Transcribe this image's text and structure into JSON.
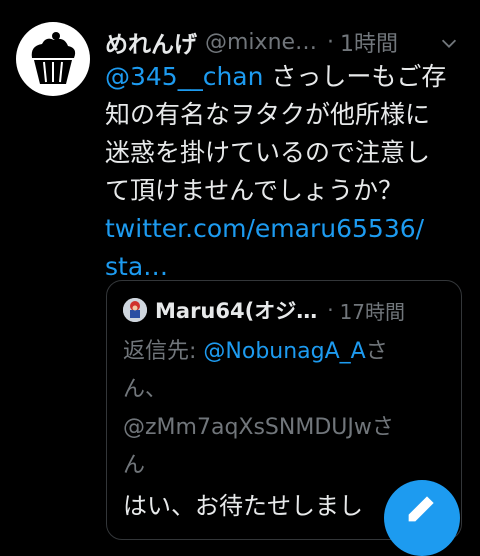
{
  "tweet": {
    "display_name": "めれんげ",
    "handle": "@mixne…",
    "separator": "·",
    "time": "1時間",
    "text": {
      "mention": "@345__chan",
      "line1_rest": " さっしーもご存",
      "line2": "知の有名なヲタクが他所様に",
      "line3": "迷惑を掛けているので注意し",
      "line4": "て頂けませんでしょうか？",
      "link_line1": "twitter.com/emaru65536/",
      "link_line2": "sta…"
    },
    "avatar_icon": "cupcake-icon"
  },
  "quoted_tweet": {
    "display_name": "Maru64(オジ…",
    "separator": "·",
    "time": "17時間",
    "reply_label": "返信先: ",
    "reply_mention_1": "@NobunagA_A",
    "reply_suffix_1": "さ",
    "reply_line2": "ん、",
    "reply_mention_2": "@zMm7aqXsSNMDUJw",
    "reply_suffix_2": "さ",
    "reply_line4": "ん",
    "text": "はい、お待たせしまし"
  },
  "colors": {
    "background": "#000000",
    "text": "#e7e9ea",
    "muted": "#71767b",
    "accent": "#1d9bf0",
    "border": "#333639"
  },
  "icons": {
    "caret": "chevron-down-icon",
    "compose": "compose-icon"
  }
}
